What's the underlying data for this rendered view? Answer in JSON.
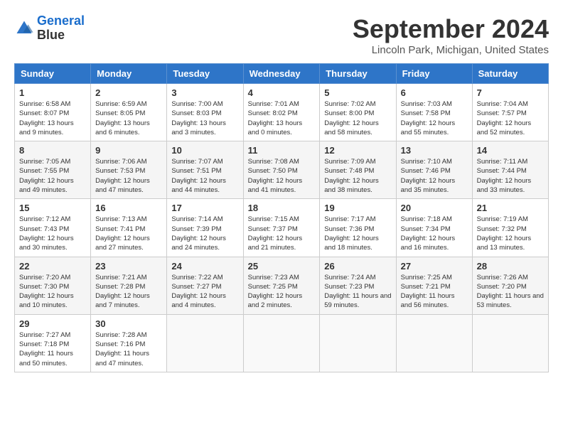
{
  "header": {
    "logo_general": "General",
    "logo_blue": "Blue",
    "month_year": "September 2024",
    "location": "Lincoln Park, Michigan, United States"
  },
  "weekdays": [
    "Sunday",
    "Monday",
    "Tuesday",
    "Wednesday",
    "Thursday",
    "Friday",
    "Saturday"
  ],
  "weeks": [
    [
      {
        "day": "1",
        "sunrise": "6:58 AM",
        "sunset": "8:07 PM",
        "daylight": "13 hours and 9 minutes."
      },
      {
        "day": "2",
        "sunrise": "6:59 AM",
        "sunset": "8:05 PM",
        "daylight": "13 hours and 6 minutes."
      },
      {
        "day": "3",
        "sunrise": "7:00 AM",
        "sunset": "8:03 PM",
        "daylight": "13 hours and 3 minutes."
      },
      {
        "day": "4",
        "sunrise": "7:01 AM",
        "sunset": "8:02 PM",
        "daylight": "13 hours and 0 minutes."
      },
      {
        "day": "5",
        "sunrise": "7:02 AM",
        "sunset": "8:00 PM",
        "daylight": "12 hours and 58 minutes."
      },
      {
        "day": "6",
        "sunrise": "7:03 AM",
        "sunset": "7:58 PM",
        "daylight": "12 hours and 55 minutes."
      },
      {
        "day": "7",
        "sunrise": "7:04 AM",
        "sunset": "7:57 PM",
        "daylight": "12 hours and 52 minutes."
      }
    ],
    [
      {
        "day": "8",
        "sunrise": "7:05 AM",
        "sunset": "7:55 PM",
        "daylight": "12 hours and 49 minutes."
      },
      {
        "day": "9",
        "sunrise": "7:06 AM",
        "sunset": "7:53 PM",
        "daylight": "12 hours and 47 minutes."
      },
      {
        "day": "10",
        "sunrise": "7:07 AM",
        "sunset": "7:51 PM",
        "daylight": "12 hours and 44 minutes."
      },
      {
        "day": "11",
        "sunrise": "7:08 AM",
        "sunset": "7:50 PM",
        "daylight": "12 hours and 41 minutes."
      },
      {
        "day": "12",
        "sunrise": "7:09 AM",
        "sunset": "7:48 PM",
        "daylight": "12 hours and 38 minutes."
      },
      {
        "day": "13",
        "sunrise": "7:10 AM",
        "sunset": "7:46 PM",
        "daylight": "12 hours and 35 minutes."
      },
      {
        "day": "14",
        "sunrise": "7:11 AM",
        "sunset": "7:44 PM",
        "daylight": "12 hours and 33 minutes."
      }
    ],
    [
      {
        "day": "15",
        "sunrise": "7:12 AM",
        "sunset": "7:43 PM",
        "daylight": "12 hours and 30 minutes."
      },
      {
        "day": "16",
        "sunrise": "7:13 AM",
        "sunset": "7:41 PM",
        "daylight": "12 hours and 27 minutes."
      },
      {
        "day": "17",
        "sunrise": "7:14 AM",
        "sunset": "7:39 PM",
        "daylight": "12 hours and 24 minutes."
      },
      {
        "day": "18",
        "sunrise": "7:15 AM",
        "sunset": "7:37 PM",
        "daylight": "12 hours and 21 minutes."
      },
      {
        "day": "19",
        "sunrise": "7:17 AM",
        "sunset": "7:36 PM",
        "daylight": "12 hours and 18 minutes."
      },
      {
        "day": "20",
        "sunrise": "7:18 AM",
        "sunset": "7:34 PM",
        "daylight": "12 hours and 16 minutes."
      },
      {
        "day": "21",
        "sunrise": "7:19 AM",
        "sunset": "7:32 PM",
        "daylight": "12 hours and 13 minutes."
      }
    ],
    [
      {
        "day": "22",
        "sunrise": "7:20 AM",
        "sunset": "7:30 PM",
        "daylight": "12 hours and 10 minutes."
      },
      {
        "day": "23",
        "sunrise": "7:21 AM",
        "sunset": "7:28 PM",
        "daylight": "12 hours and 7 minutes."
      },
      {
        "day": "24",
        "sunrise": "7:22 AM",
        "sunset": "7:27 PM",
        "daylight": "12 hours and 4 minutes."
      },
      {
        "day": "25",
        "sunrise": "7:23 AM",
        "sunset": "7:25 PM",
        "daylight": "12 hours and 2 minutes."
      },
      {
        "day": "26",
        "sunrise": "7:24 AM",
        "sunset": "7:23 PM",
        "daylight": "11 hours and 59 minutes."
      },
      {
        "day": "27",
        "sunrise": "7:25 AM",
        "sunset": "7:21 PM",
        "daylight": "11 hours and 56 minutes."
      },
      {
        "day": "28",
        "sunrise": "7:26 AM",
        "sunset": "7:20 PM",
        "daylight": "11 hours and 53 minutes."
      }
    ],
    [
      {
        "day": "29",
        "sunrise": "7:27 AM",
        "sunset": "7:18 PM",
        "daylight": "11 hours and 50 minutes."
      },
      {
        "day": "30",
        "sunrise": "7:28 AM",
        "sunset": "7:16 PM",
        "daylight": "11 hours and 47 minutes."
      },
      null,
      null,
      null,
      null,
      null
    ]
  ]
}
